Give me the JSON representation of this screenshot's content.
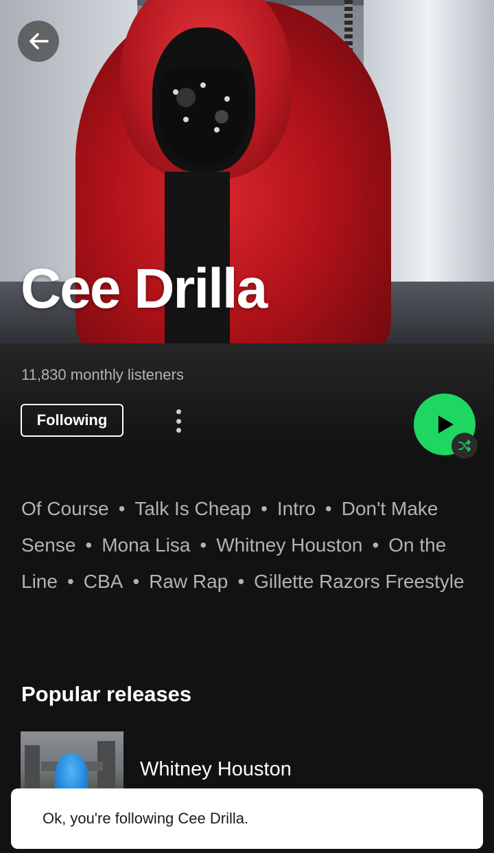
{
  "artist": {
    "name": "Cee Drilla",
    "monthly_listeners": "11,830 monthly listeners"
  },
  "actions": {
    "follow_label": "Following"
  },
  "featured_tracks": [
    "Of Course",
    "Talk Is Cheap",
    "Intro",
    "Don't Make Sense",
    "Mona Lisa",
    "Whitney Houston",
    "On the Line",
    "CBA",
    "Raw Rap",
    "Gillette Razors Freestyle"
  ],
  "popular_releases": {
    "title": "Popular releases",
    "items": [
      {
        "title": "Whitney Houston"
      }
    ]
  },
  "toast": {
    "message": "Ok, you're following Cee Drilla."
  },
  "icons": {
    "back": "arrow-left-icon",
    "more": "more-vertical-icon",
    "play": "play-icon",
    "shuffle": "shuffle-icon"
  },
  "colors": {
    "accent": "#1ed760",
    "background": "#121212",
    "secondary_text": "#b3b3b3"
  }
}
